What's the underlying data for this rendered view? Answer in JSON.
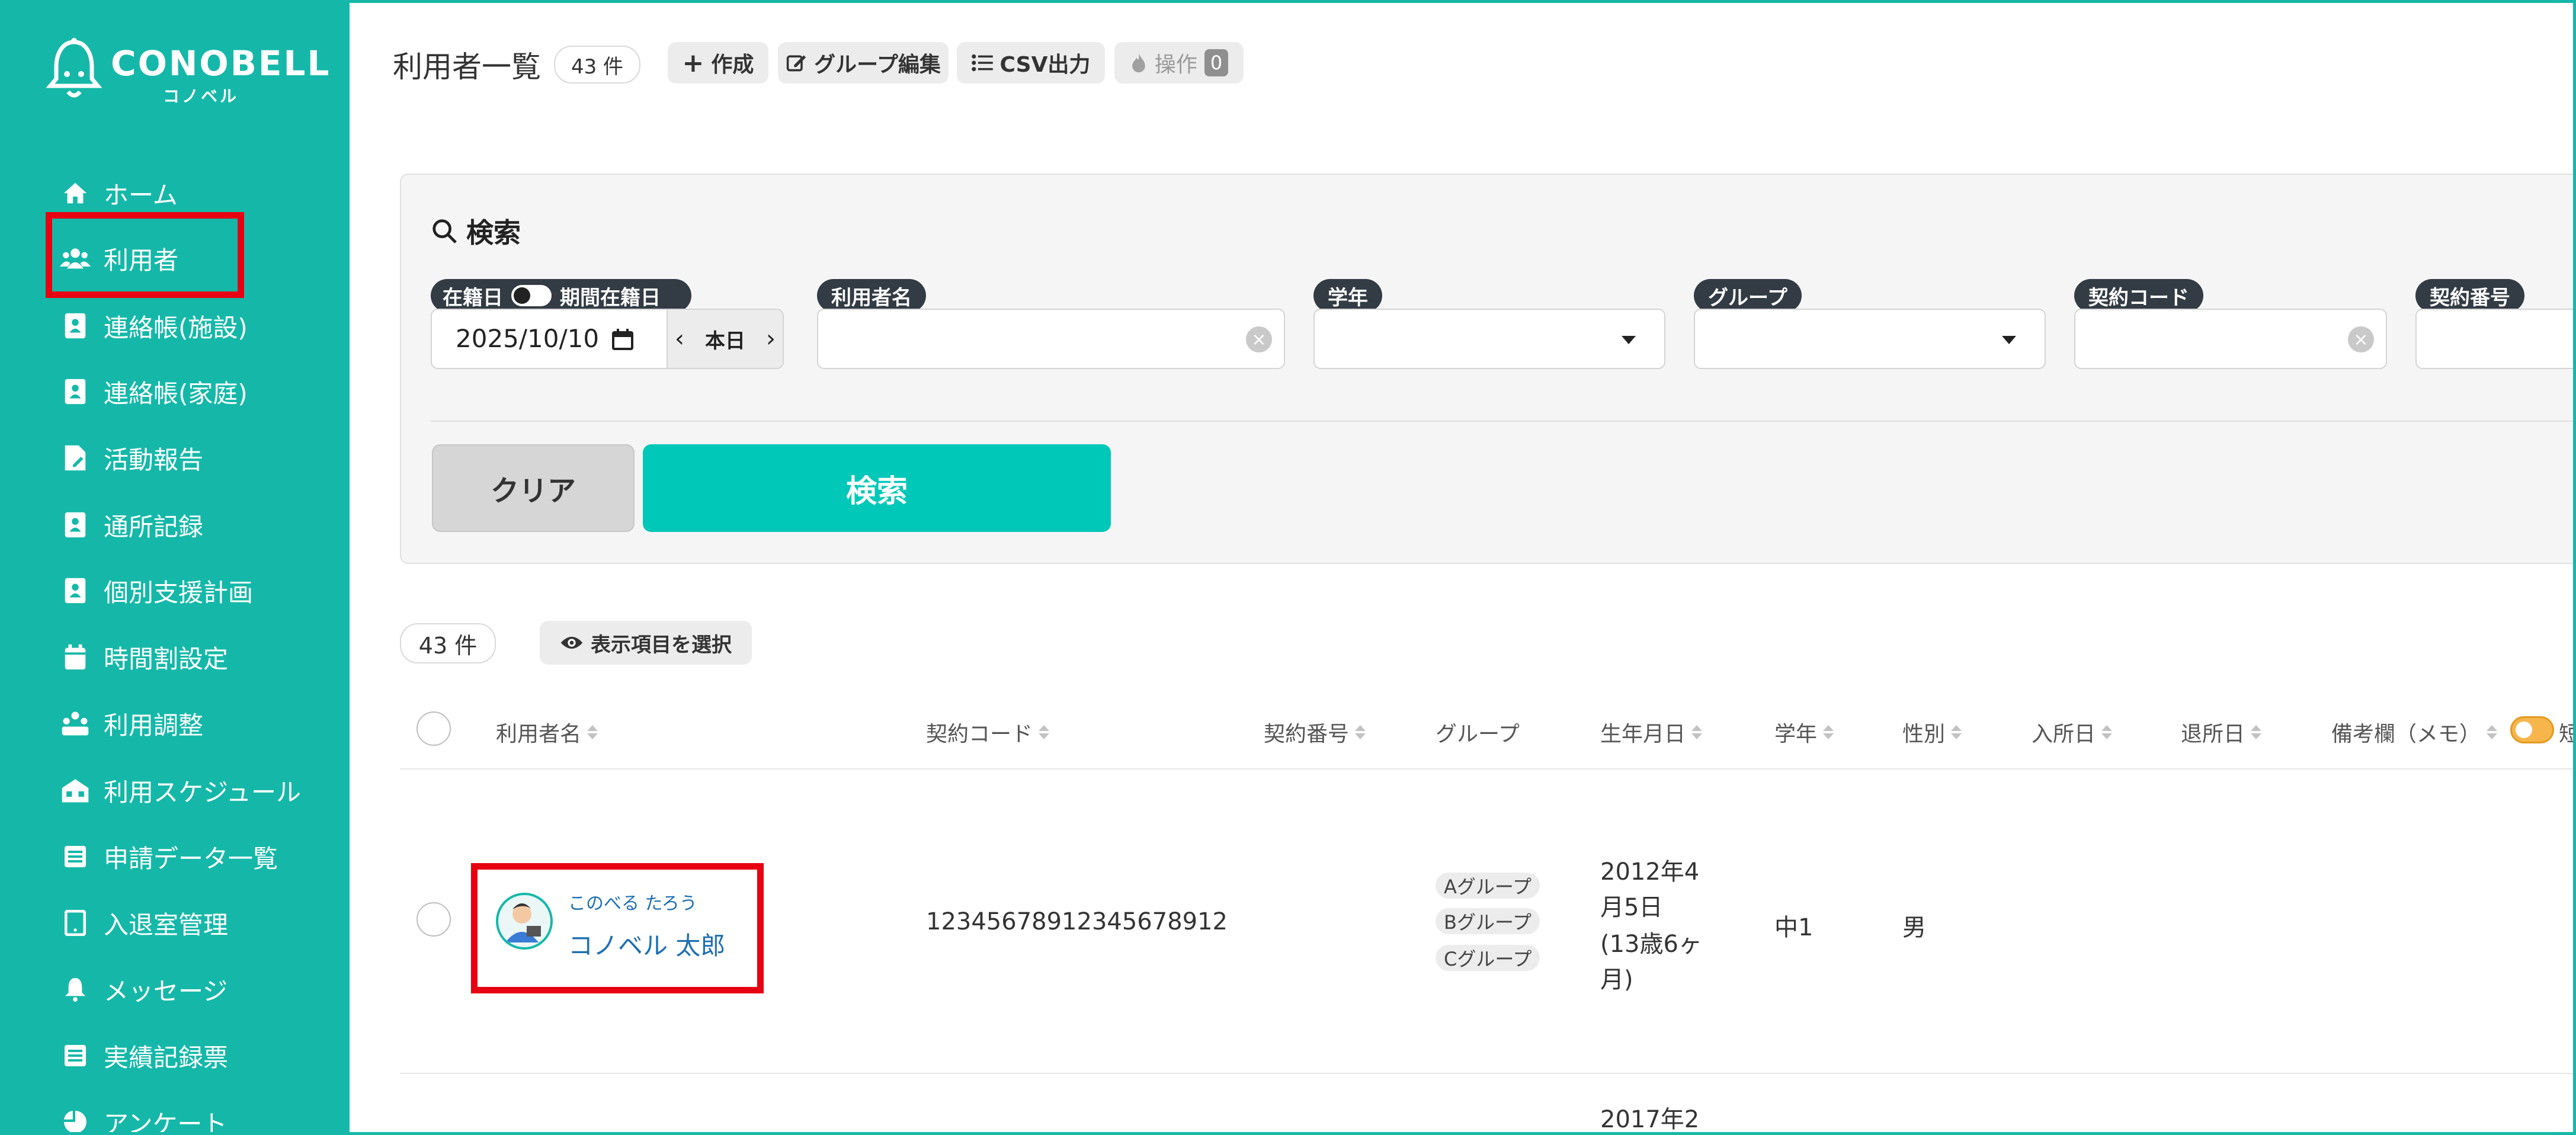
{
  "brand": {
    "name": "CONOBELL",
    "sub": "コノベル"
  },
  "nav": [
    {
      "label": "ホーム",
      "icon": "home-icon"
    },
    {
      "label": "利用者",
      "icon": "users-icon"
    },
    {
      "label": "連絡帳(施設)",
      "icon": "contact-book-icon"
    },
    {
      "label": "連絡帳(家庭)",
      "icon": "contact-book-icon"
    },
    {
      "label": "活動報告",
      "icon": "file-edit-icon"
    },
    {
      "label": "通所記録",
      "icon": "contact-book-icon"
    },
    {
      "label": "個別支援計画",
      "icon": "contact-book-icon"
    },
    {
      "label": "時間割設定",
      "icon": "calendar-icon"
    },
    {
      "label": "利用調整",
      "icon": "group-adjust-icon"
    },
    {
      "label": "利用スケジュール",
      "icon": "schedule-icon"
    },
    {
      "label": "申請データ一覧",
      "icon": "table-icon"
    },
    {
      "label": "入退室管理",
      "icon": "tablet-icon"
    },
    {
      "label": "メッセージ",
      "icon": "bell-icon"
    },
    {
      "label": "実績記録票",
      "icon": "table-icon"
    },
    {
      "label": "アンケート",
      "icon": "pie-chart-icon"
    }
  ],
  "header": {
    "title": "利用者一覧",
    "count": "43 件",
    "create": "作成",
    "group_edit": "グループ編集",
    "csv": "CSV出力",
    "ops": "操作",
    "ops_count": "0"
  },
  "search": {
    "title": "検索",
    "enrolled_label": "在籍日",
    "period_label": "期間在籍日",
    "date_value": "2025/10/10",
    "today": "本日",
    "name_label": "利用者名",
    "grade_label": "学年",
    "group_label": "グループ",
    "contract_code_label": "契約コード",
    "contract_no_label": "契約番号",
    "clear_btn": "クリア",
    "search_btn": "検索"
  },
  "results": {
    "count": "43 件",
    "select_columns": "表示項目を選択",
    "columns": [
      "利用者名",
      "契約コード",
      "契約番号",
      "グループ",
      "生年月日",
      "学年",
      "性別",
      "入所日",
      "退所日",
      "備考欄（メモ）",
      "短"
    ],
    "rows": [
      {
        "kana": "このべる たろう",
        "name": "コノベル 太郎",
        "contract_code": "12345678912345678912",
        "groups": [
          "Aグループ",
          "Bグループ",
          "Cグループ"
        ],
        "birth_lines": [
          "2012年4",
          "月5日",
          "(13歳6ヶ",
          "月)"
        ],
        "grade": "中1",
        "gender": "男"
      },
      {
        "birth_lines": [
          "2017年2"
        ]
      }
    ]
  },
  "colors": {
    "sidebar": "#15b8a8",
    "accent": "#00c8b9",
    "highlight": "#e60012"
  }
}
